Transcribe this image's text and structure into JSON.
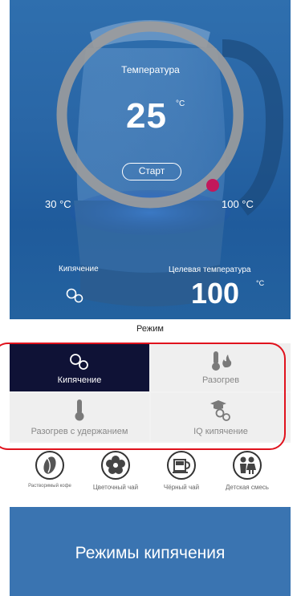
{
  "display": {
    "temp_label": "Температура",
    "current_temp": "25",
    "temp_unit": "°C",
    "start_label": "Старт",
    "range_min": "30 °C",
    "range_max": "100 °C",
    "boil_label": "Кипячение",
    "target_label": "Целевая температура",
    "target_value": "100",
    "target_unit": "°C"
  },
  "mode": {
    "title": "Режим",
    "items": [
      {
        "label": "Кипячение",
        "icon": "bubbles-icon",
        "active": true
      },
      {
        "label": "Разогрев",
        "icon": "thermometer-flame-icon",
        "active": false
      },
      {
        "label": "Разогрев с удержанием",
        "icon": "thermometer-icon",
        "active": false
      },
      {
        "label": "IQ кипячение",
        "icon": "graduation-bubbles-icon",
        "active": false
      }
    ]
  },
  "presets": [
    {
      "label": "Растворимый кофе",
      "icon": "coffee-bean-icon"
    },
    {
      "label": "Цветочный чай",
      "icon": "flower-icon"
    },
    {
      "label": "Чёрный чай",
      "icon": "tea-cup-icon"
    },
    {
      "label": "Детская смесь",
      "icon": "children-icon"
    }
  ],
  "footer": {
    "caption": "Режимы кипячения"
  },
  "colors": {
    "accent": "#c2185b",
    "active_mode_bg": "#0f1236",
    "outline": "#e0121d",
    "footer_bg": "#3a74b1"
  }
}
